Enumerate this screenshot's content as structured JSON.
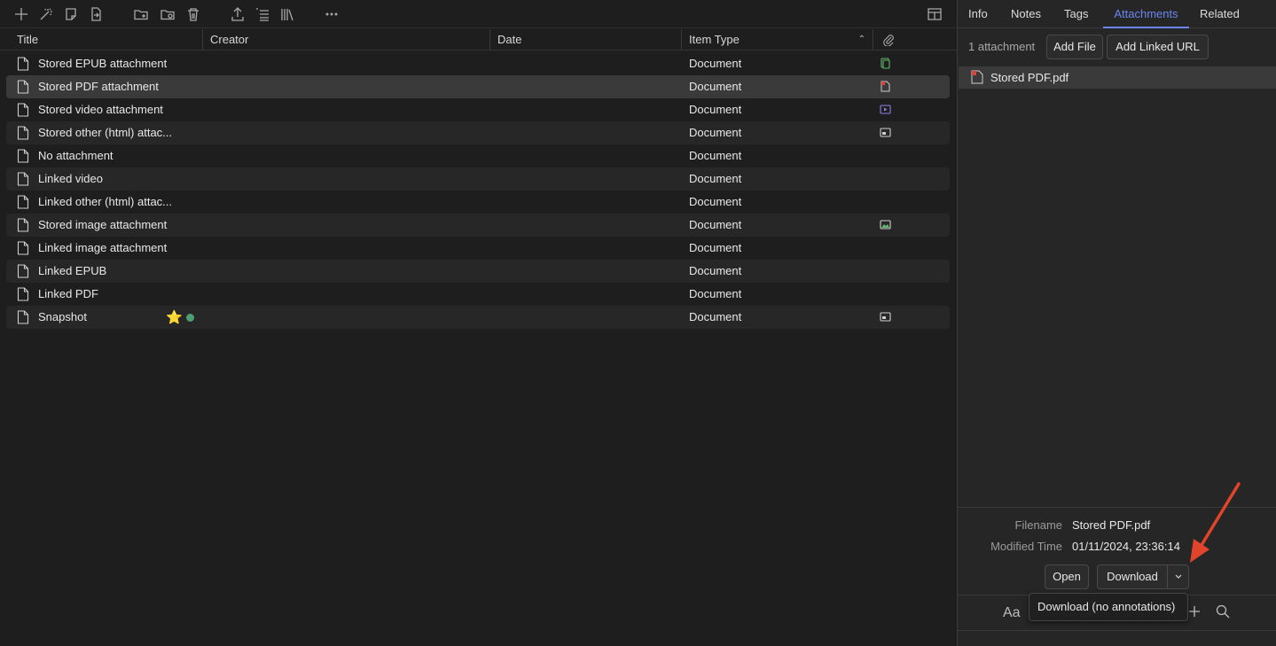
{
  "columns": {
    "title": "Title",
    "creator": "Creator",
    "date": "Date",
    "item_type": "Item Type"
  },
  "rows": [
    {
      "title": "Stored EPUB attachment",
      "item_type": "Document",
      "attachment": "epub"
    },
    {
      "title": "Stored PDF attachment",
      "item_type": "Document",
      "attachment": "pdf"
    },
    {
      "title": "Stored video attachment",
      "item_type": "Document",
      "attachment": "video"
    },
    {
      "title": "Stored other (html) attac...",
      "item_type": "Document",
      "attachment": "snapshot"
    },
    {
      "title": "No attachment",
      "item_type": "Document",
      "attachment": ""
    },
    {
      "title": "Linked video",
      "item_type": "Document",
      "attachment": ""
    },
    {
      "title": "Linked other (html) attac...",
      "item_type": "Document",
      "attachment": ""
    },
    {
      "title": "Stored image attachment",
      "item_type": "Document",
      "attachment": "image"
    },
    {
      "title": "Linked image attachment",
      "item_type": "Document",
      "attachment": ""
    },
    {
      "title": "Linked EPUB",
      "item_type": "Document",
      "attachment": ""
    },
    {
      "title": "Linked PDF",
      "item_type": "Document",
      "attachment": ""
    },
    {
      "title": "Snapshot",
      "item_type": "Document",
      "attachment": "snapshot",
      "emoji": "⭐"
    }
  ],
  "pane": {
    "tabs": [
      "Info",
      "Notes",
      "Tags",
      "Attachments",
      "Related"
    ],
    "active_tab": "Attachments",
    "attachment_count": "1 attachment",
    "add_file": "Add File",
    "add_linked_url": "Add Linked URL",
    "attachment_name": "Stored PDF.pdf",
    "filename_label": "Filename",
    "filename_value": "Stored PDF.pdf",
    "modified_label": "Modified Time",
    "modified_value": "01/11/2024, 23:36:14",
    "open_button": "Open",
    "download_button": "Download",
    "tooltip": "Download (no annotations)",
    "font_button": "Aa"
  },
  "colors": {
    "accent": "#6b86f0",
    "arrow": "#e0452b",
    "tag_dot": "#4d9e73"
  }
}
